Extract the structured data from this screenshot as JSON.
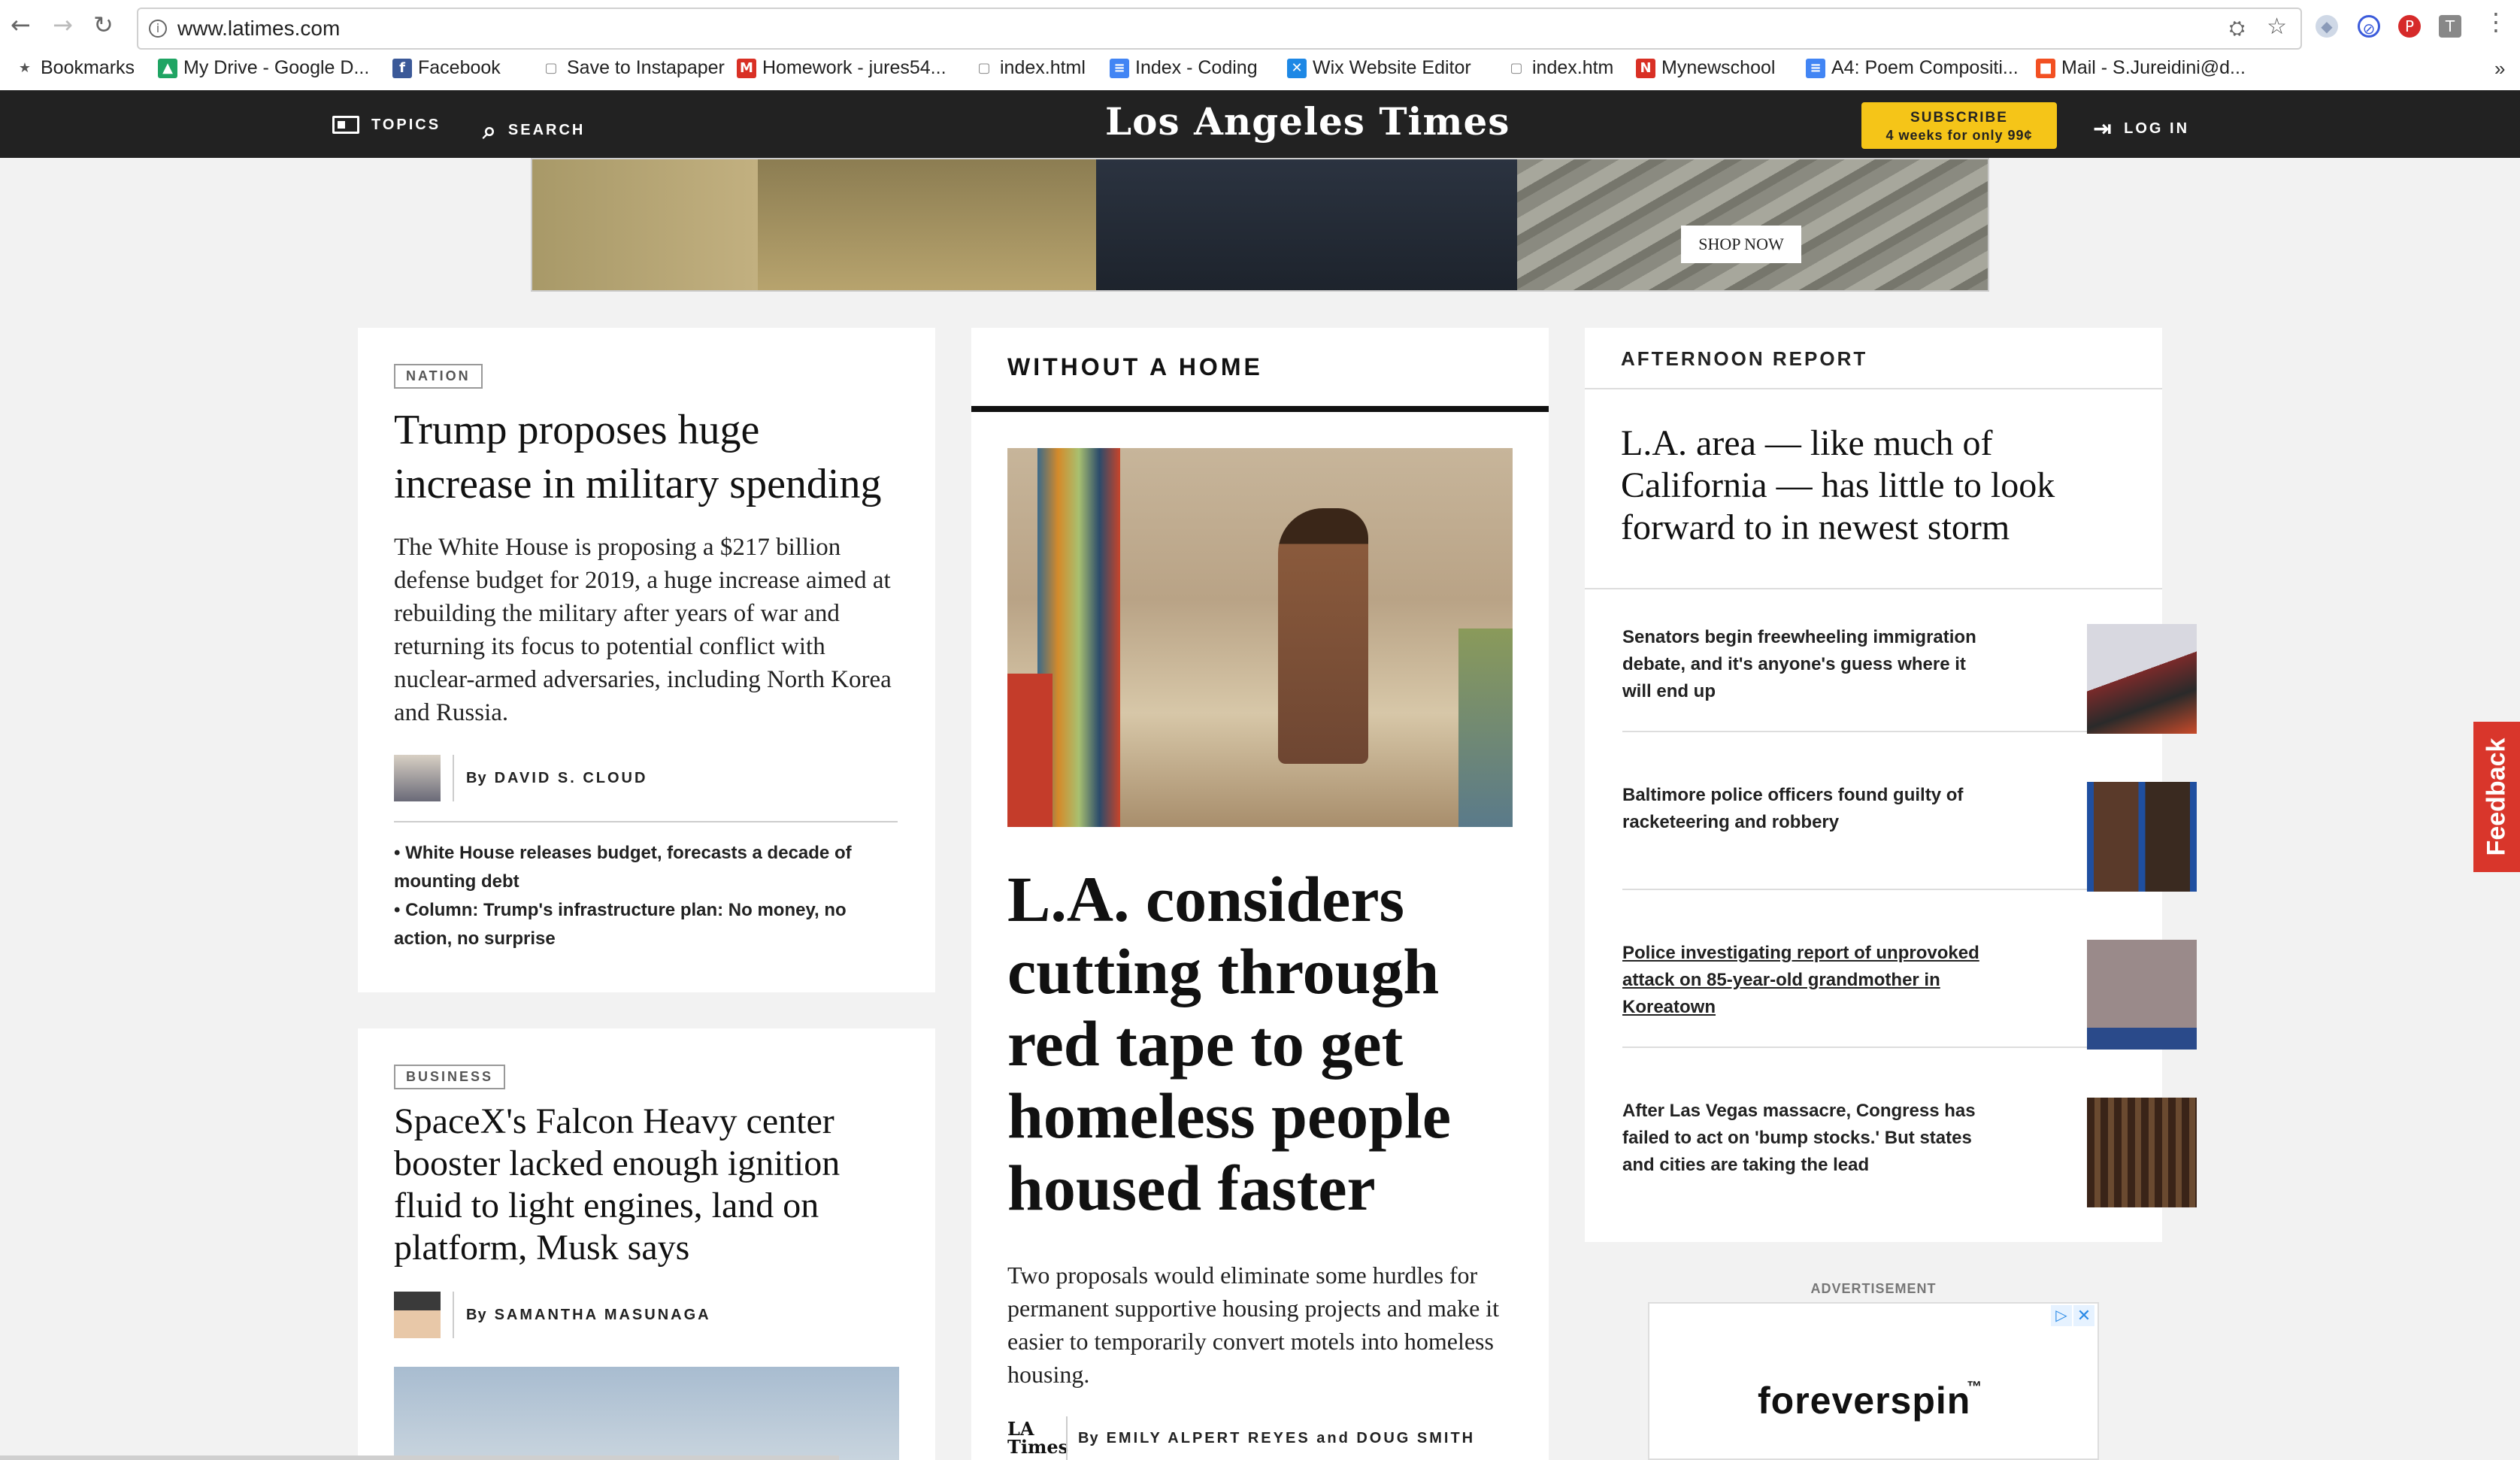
{
  "browser": {
    "url": "www.latimes.com",
    "bookmarks": [
      {
        "label": "Bookmarks",
        "icon": "star-icon",
        "color": "#555555"
      },
      {
        "label": "My Drive - Google D...",
        "icon": "google-drive-icon",
        "color": "#1fa463"
      },
      {
        "label": "Facebook",
        "icon": "facebook-icon",
        "color": "#3b5998"
      },
      {
        "label": "Save to Instapaper",
        "icon": "page-icon",
        "color": "#888888"
      },
      {
        "label": "Homework - jures54...",
        "icon": "gmail-icon",
        "color": "#d93025"
      },
      {
        "label": "index.html",
        "icon": "page-icon",
        "color": "#888888"
      },
      {
        "label": "Index - Coding",
        "icon": "docs-icon",
        "color": "#4285f4"
      },
      {
        "label": "Wix Website Editor",
        "icon": "wix-icon",
        "color": "#1e88e5"
      },
      {
        "label": "index.htm",
        "icon": "page-icon",
        "color": "#888888"
      },
      {
        "label": "Mynewschool",
        "icon": "newschool-icon",
        "color": "#d93025"
      },
      {
        "label": "A4: Poem Compositi...",
        "icon": "docs-icon",
        "color": "#4285f4"
      },
      {
        "label": "Mail - S.Jureidini@d...",
        "icon": "microsoft-icon",
        "color": "#f25022"
      }
    ],
    "more": "»"
  },
  "site": {
    "topics": "TOPICS",
    "search": "SEARCH",
    "logo": "Los Angeles Times",
    "subscribe_line1": "SUBSCRIBE",
    "subscribe_line2": "4 weeks for only 99¢",
    "login": "LOG IN"
  },
  "ad_banner": {
    "cta": "SHOP NOW"
  },
  "left_column": {
    "story1": {
      "section": "NATION",
      "headline": "Trump proposes huge increase in military spending",
      "summary": "The White House is proposing a $217 billion defense budget for 2019, a huge increase aimed at rebuilding the military after years of war and returning its focus to potential conflict with nuclear-armed adversaries, including North Korea and Russia.",
      "by": "By",
      "author": "DAVID S. CLOUD",
      "related": [
        "• White House releases budget, forecasts a decade of mounting debt",
        "• Column: Trump's infrastructure plan: No money, no action, no surprise"
      ]
    },
    "story2": {
      "section": "BUSINESS",
      "headline": "SpaceX's Falcon Heavy center booster lacked enough ignition fluid to light engines, land on platform, Musk says",
      "by": "By",
      "author": "SAMANTHA MASUNAGA"
    }
  },
  "center_column": {
    "section": "WITHOUT A HOME",
    "headline": "L.A. considers cutting through red tape to get homeless people housed faster",
    "summary": "Two proposals would eliminate some hurdles for permanent supportive housing projects and make it easier to temporarily convert motels into homeless housing.",
    "logo_mark": "LA Times",
    "by": "By",
    "authors": "EMILY ALPERT REYES and DOUG SMITH"
  },
  "right_column": {
    "section": "AFTERNOON REPORT",
    "lead": "L.A. area — like much of California — has little to look forward to in newest storm",
    "stories": [
      {
        "title": "Senators begin freewheeling immigration debate, and it's anyone's guess where it will end up"
      },
      {
        "title": "Baltimore police officers found guilty of racketeering and robbery"
      },
      {
        "title": "Police investigating report of unprovoked attack on 85-year-old grandmother in Koreatown"
      },
      {
        "title": "After Las Vegas massacre, Congress has failed to act on 'bump stocks.' But states and cities are taking the lead"
      }
    ],
    "ad_label": "ADVERTISEMENT",
    "ad_brand": "foreverspin",
    "ad_tm": "™"
  },
  "feedback": "Feedback"
}
